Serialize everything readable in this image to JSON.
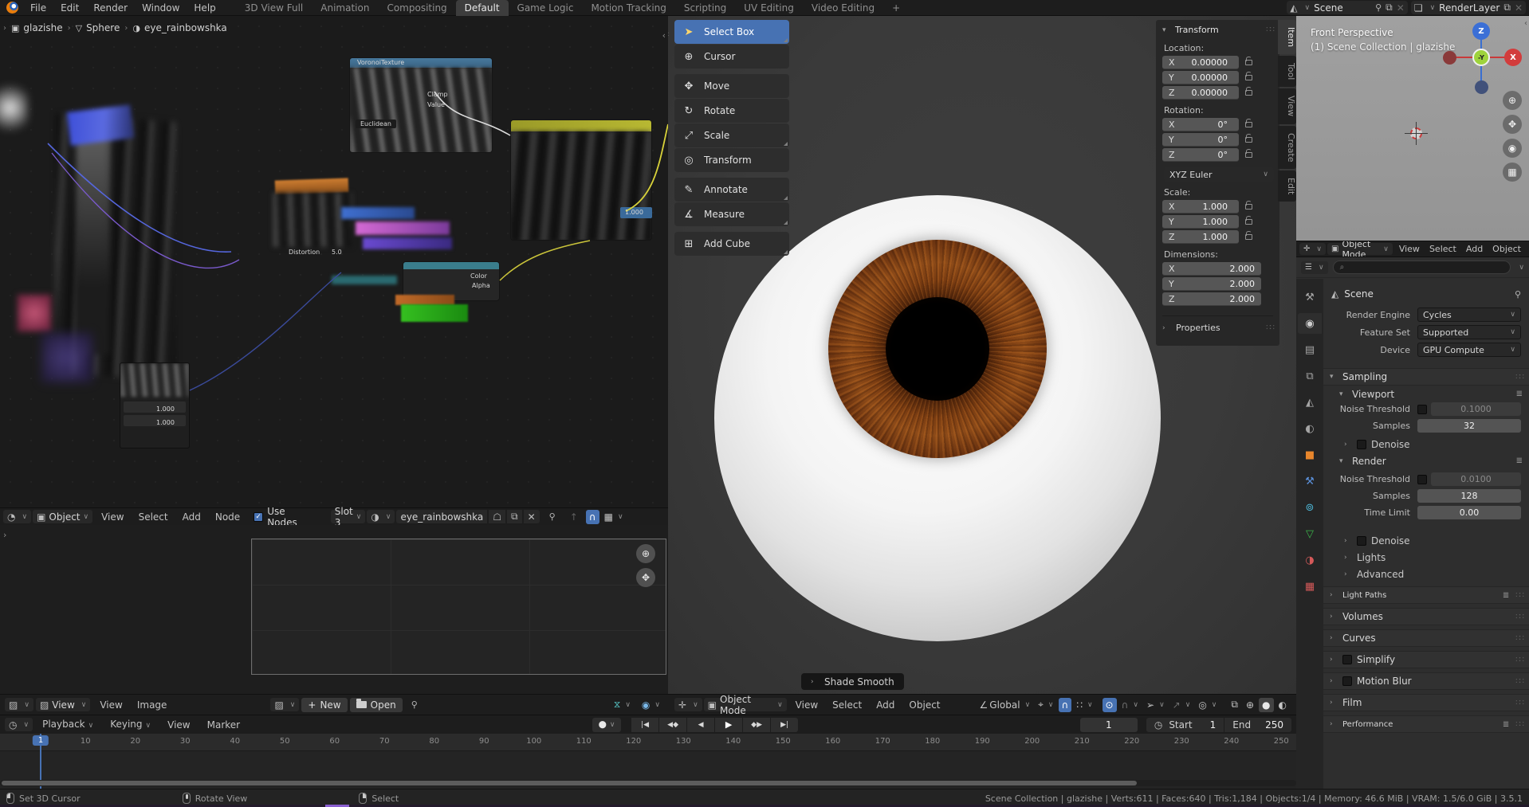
{
  "topbar": {
    "menus": [
      "File",
      "Edit",
      "Render",
      "Window",
      "Help"
    ],
    "workspaces": [
      {
        "label": "3D View Full"
      },
      {
        "label": "Animation"
      },
      {
        "label": "Compositing"
      },
      {
        "label": "Default",
        "active": true
      },
      {
        "label": "Game Logic"
      },
      {
        "label": "Motion Tracking"
      },
      {
        "label": "Scripting"
      },
      {
        "label": "UV Editing"
      },
      {
        "label": "Video Editing"
      },
      {
        "label": "+"
      }
    ],
    "scene_name": "Scene",
    "render_layer_name": "RenderLayer"
  },
  "node_editor": {
    "breadcrumb": {
      "object": "glazishe",
      "mesh": "Sphere",
      "material": "eye_rainbowshka"
    },
    "node_labels": {
      "voronoi": "VoronoiTexture",
      "clamp": "Clamp",
      "value": "Value",
      "euclidean": "Euclidean",
      "distortion": "Distortion",
      "distortion_value": "5.0",
      "color": "Color",
      "alpha": "Alpha",
      "badge": "1.000",
      "small_value_1": "1.000",
      "small_value_2": "1.000"
    },
    "header": {
      "mode": "Object",
      "menus": [
        "View",
        "Select",
        "Add",
        "Node"
      ],
      "use_nodes_label": "Use Nodes",
      "slot": "Slot 3",
      "material_name": "eye_rainbowshka"
    }
  },
  "image_editor": {
    "header": {
      "mode": "View",
      "menus": [
        "View",
        "Image"
      ],
      "new_label": "New",
      "open_label": "Open"
    }
  },
  "viewport": {
    "tools": [
      {
        "name": "select-box",
        "glyph": "➤",
        "label": "Select Box",
        "active": true,
        "corner": true
      },
      {
        "name": "cursor",
        "glyph": "⊕",
        "label": "Cursor"
      },
      {
        "name": "move",
        "glyph": "✥",
        "label": "Move",
        "gap": true
      },
      {
        "name": "rotate",
        "glyph": "↻",
        "label": "Rotate"
      },
      {
        "name": "scale",
        "glyph": "⤢",
        "label": "Scale",
        "corner": true
      },
      {
        "name": "transform",
        "glyph": "◎",
        "label": "Transform"
      },
      {
        "name": "annotate",
        "glyph": "✎",
        "label": "Annotate",
        "gap": true,
        "corner": true
      },
      {
        "name": "measure",
        "glyph": "∡",
        "label": "Measure",
        "corner": true
      },
      {
        "name": "add-cube",
        "glyph": "⊞",
        "label": "Add Cube",
        "gap": true,
        "corner": true
      }
    ],
    "shade_smooth_label": "Shade Smooth",
    "header": {
      "mode": "Object Mode",
      "menus": [
        "View",
        "Select",
        "Add",
        "Object"
      ],
      "orientation": "Global"
    },
    "npanel": {
      "transform_title": "Transform",
      "location_label": "Location:",
      "loc": [
        {
          "axis": "X",
          "value": "0.00000"
        },
        {
          "axis": "Y",
          "value": "0.00000"
        },
        {
          "axis": "Z",
          "value": "0.00000"
        }
      ],
      "rotation_label": "Rotation:",
      "rot": [
        {
          "axis": "X",
          "value": "0°"
        },
        {
          "axis": "Y",
          "value": "0°"
        },
        {
          "axis": "Z",
          "value": "0°"
        }
      ],
      "euler_mode": "XYZ Euler",
      "scale_label": "Scale:",
      "scale": [
        {
          "axis": "X",
          "value": "1.000"
        },
        {
          "axis": "Y",
          "value": "1.000"
        },
        {
          "axis": "Z",
          "value": "1.000"
        }
      ],
      "dimensions_label": "Dimensions:",
      "dims": [
        {
          "axis": "X",
          "value": "2.000"
        },
        {
          "axis": "Y",
          "value": "2.000"
        },
        {
          "axis": "Z",
          "value": "2.000"
        }
      ],
      "properties_label": "Properties",
      "tabs": [
        {
          "label": "Item",
          "active": true
        },
        {
          "label": "Tool"
        },
        {
          "label": "View"
        },
        {
          "label": "Create"
        },
        {
          "label": "Edit"
        }
      ]
    }
  },
  "mini_viewport": {
    "view_label": "Front Perspective",
    "collection_label": "(1) Scene Collection | glazishe",
    "gizmo": {
      "z": "Z",
      "x": "X",
      "y": "-Y"
    },
    "header": {
      "mode": "Object Mode",
      "menus": [
        "View",
        "Select",
        "Add",
        "Object"
      ]
    }
  },
  "properties": {
    "tabs": [
      {
        "name": "tool",
        "glyph": "⚒",
        "color": "#a5a5a5"
      },
      {
        "name": "render",
        "glyph": "◉",
        "color": "#cfcfcf",
        "active": true
      },
      {
        "name": "output",
        "glyph": "▤",
        "color": "#a5a5a5"
      },
      {
        "name": "view-layer",
        "glyph": "⧉",
        "color": "#a5a5a5"
      },
      {
        "name": "scene",
        "glyph": "◭",
        "color": "#a5a5a5"
      },
      {
        "name": "world",
        "glyph": "◐",
        "color": "#a5a5a5"
      },
      {
        "name": "object",
        "glyph": "■",
        "color": "#e8862c"
      },
      {
        "name": "modifiers",
        "glyph": "⚒",
        "color": "#5a8fd8"
      },
      {
        "name": "physics",
        "glyph": "⊚",
        "color": "#4db8d8"
      },
      {
        "name": "object-data",
        "glyph": "▽",
        "color": "#3cb54a"
      },
      {
        "name": "material",
        "glyph": "◑",
        "color": "#d45959"
      },
      {
        "name": "texture",
        "glyph": "▦",
        "color": "#d45959"
      }
    ],
    "breadcrumb": "Scene",
    "engine_rows": [
      {
        "label": "Render Engine",
        "value": "Cycles"
      },
      {
        "label": "Feature Set",
        "value": "Supported"
      },
      {
        "label": "Device",
        "value": "GPU Compute"
      }
    ],
    "sampling": {
      "title": "Sampling",
      "viewport_title": "Viewport",
      "vp_noise_label": "Noise Threshold",
      "vp_noise_value": "0.1000",
      "vp_samples_label": "Samples",
      "vp_samples_value": "32",
      "vp_denoise_label": "Denoise",
      "render_title": "Render",
      "r_noise_label": "Noise Threshold",
      "r_noise_value": "0.0100",
      "r_samples_label": "Samples",
      "r_samples_value": "128",
      "r_time_label": "Time Limit",
      "r_time_value": "0.00",
      "r_denoise_label": "Denoise",
      "lights_label": "Lights",
      "advanced_label": "Advanced"
    },
    "sections": [
      {
        "label": "Light Paths",
        "preset": true
      },
      {
        "label": "Volumes"
      },
      {
        "label": "Curves"
      },
      {
        "label": "Simplify",
        "checkbox": true
      },
      {
        "label": "Motion Blur",
        "checkbox": true
      },
      {
        "label": "Film"
      },
      {
        "label": "Performance",
        "preset": true
      }
    ]
  },
  "timeline": {
    "header": {
      "playback_label": "Playback",
      "keying_label": "Keying",
      "view_label": "View",
      "marker_label": "Marker"
    },
    "current_frame": "1",
    "start_label": "Start",
    "start_value": "1",
    "end_label": "End",
    "end_value": "250",
    "playhead_label": "1",
    "ruler_frames": [
      10,
      20,
      30,
      40,
      50,
      60,
      70,
      80,
      90,
      100,
      110,
      120,
      130,
      140,
      150,
      160,
      170,
      180,
      190,
      200,
      210,
      220,
      230,
      240,
      250
    ]
  },
  "statusbar": {
    "hints": [
      {
        "label": "Set 3D Cursor"
      },
      {
        "label": "Rotate View"
      },
      {
        "label": "Select"
      }
    ],
    "stats": "Scene Collection | glazishe | Verts:611 | Faces:640 | Tris:1,184 | Objects:1/4 | Memory: 46.6 MiB | VRAM: 1.5/6.0 GiB | 3.5.1"
  }
}
